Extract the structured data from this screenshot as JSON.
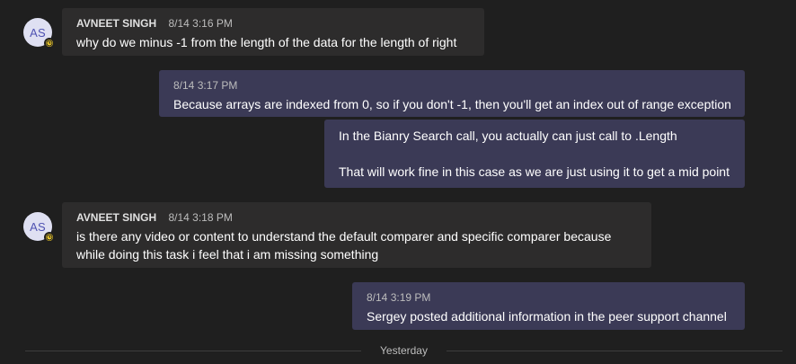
{
  "messages": [
    {
      "author": "AVNEET SINGH",
      "initials": "AS",
      "time": "8/14 3:16 PM",
      "text": "why do we minus -1 from the length of the data for the length of right"
    },
    {
      "time": "8/14 3:17 PM",
      "text": "Because arrays are indexed from 0, so if you don't -1, then you'll get an index out of range exception"
    },
    {
      "line1": "In the Bianry Search call, you actually can just call to .Length",
      "line2": "That will work fine in this case as we are just using it to get a mid point"
    },
    {
      "author": "AVNEET SINGH",
      "initials": "AS",
      "time": "8/14 3:18 PM",
      "line1": "is there any video or content to understand the default comparer and specific comparer because",
      "line2": "while doing this task i feel that i am missing something"
    },
    {
      "time": "8/14 3:19 PM",
      "text": "Sergey posted additional information in the peer support channel"
    }
  ],
  "divider": {
    "label": "Yesterday"
  },
  "icons": {
    "presence": "clock-away-icon",
    "presence_color": "#f8d22a"
  }
}
